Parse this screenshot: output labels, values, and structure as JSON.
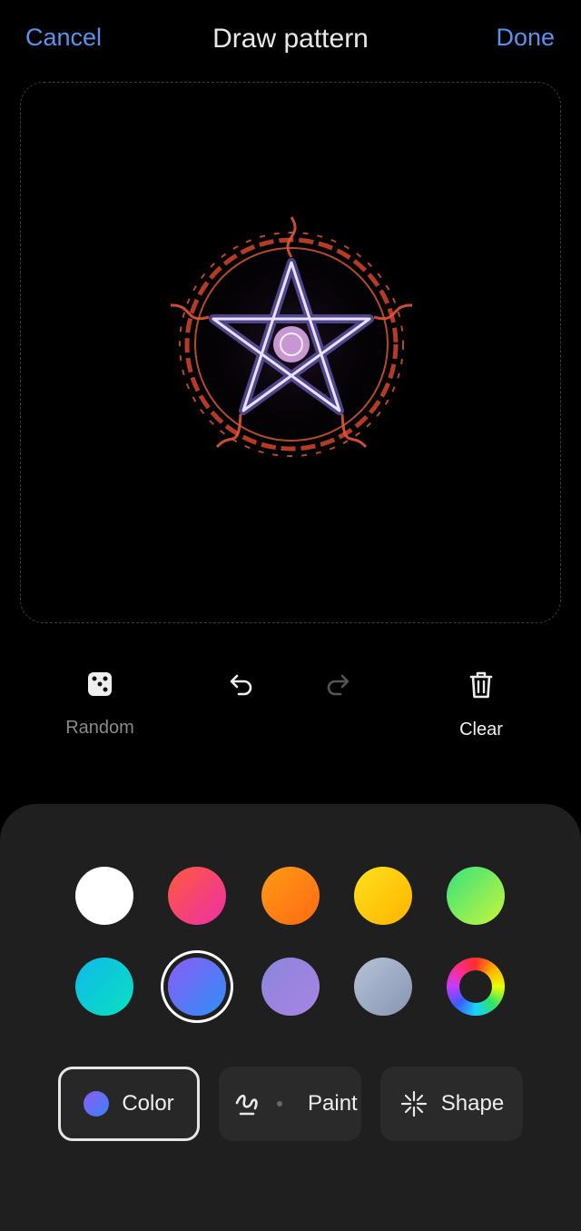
{
  "header": {
    "cancel": "Cancel",
    "title": "Draw pattern",
    "done": "Done"
  },
  "tools": {
    "random": "Random",
    "clear": "Clear"
  },
  "palette": {
    "row1": [
      "white",
      "pink-red",
      "orange",
      "yellow",
      "green"
    ],
    "row2": [
      "cyan",
      "blue-violet",
      "lavender",
      "gray-blue",
      "multicolor"
    ],
    "selected": "blue-violet"
  },
  "tabs": {
    "color": "Color",
    "paint": "Paint",
    "shape": "Shape",
    "active": "Color"
  }
}
